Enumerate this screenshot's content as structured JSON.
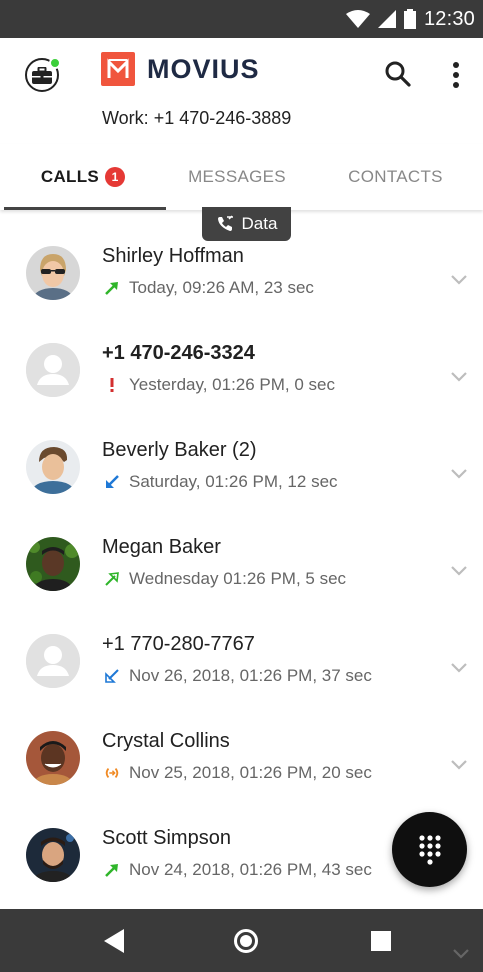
{
  "status_bar": {
    "time": "12:30"
  },
  "header": {
    "logo_text": "MOVIUS",
    "work_label": "Work:",
    "work_number": "+1 470-246-3889"
  },
  "tabs": [
    {
      "label": "CALLS",
      "badge": "1",
      "active": true
    },
    {
      "label": "MESSAGES",
      "active": false
    },
    {
      "label": "CONTACTS",
      "active": false
    }
  ],
  "data_pill": {
    "label": "Data",
    "icon": "wifi-call-icon"
  },
  "calls": [
    {
      "name": "Shirley Hoffman",
      "bold": false,
      "detail": "Today, 09:26 AM, 23 sec",
      "type": "outgoing",
      "icon_color": "#2fb52a",
      "avatar": "photo-woman-sunglasses"
    },
    {
      "name": "+1 470-246-3324",
      "bold": true,
      "detail": "Yesterday, 01:26 PM, 0 sec",
      "type": "missed",
      "icon_color": "#d32f2f",
      "avatar": "placeholder"
    },
    {
      "name": "Beverly Baker (2)",
      "bold": false,
      "detail": "Saturday, 01:26 PM, 12 sec",
      "type": "incoming",
      "icon_color": "#1e78d6",
      "avatar": "photo-man-hair"
    },
    {
      "name": "Megan Baker",
      "bold": false,
      "detail": "Wednesday 01:26 PM, 5 sec",
      "type": "outgoing-wifi",
      "icon_color": "#2fb52a",
      "avatar": "photo-man-foliage"
    },
    {
      "name": "+1 770-280-7767",
      "bold": false,
      "detail": "Nov 26, 2018, 01:26 PM, 37 sec",
      "type": "incoming-wifi",
      "icon_color": "#1e78d6",
      "avatar": "placeholder"
    },
    {
      "name": "Crystal Collins",
      "bold": false,
      "detail": "Nov 25, 2018, 01:26 PM, 20 sec",
      "type": "forwarded",
      "icon_color": "#f08a24",
      "avatar": "photo-man-smile"
    },
    {
      "name": "Scott Simpson",
      "bold": false,
      "detail": "Nov 24, 2018, 01:26 PM, 43 sec",
      "type": "outgoing",
      "icon_color": "#2fb52a",
      "avatar": "photo-man-beard"
    }
  ],
  "colors": {
    "brand": "#f0553d",
    "badge": "#e53935",
    "bars": "#3a3a3a"
  }
}
